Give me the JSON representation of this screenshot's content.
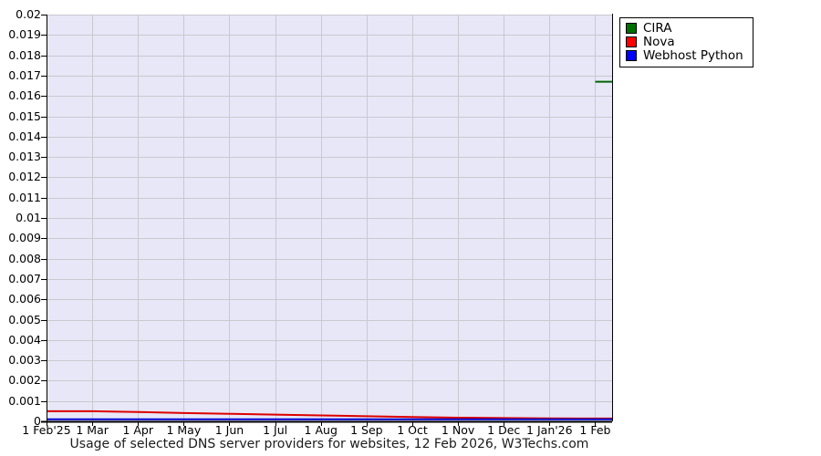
{
  "chart_data": {
    "type": "line",
    "title": "Usage of selected DNS server providers for websites, 12 Feb 2026, W3Techs.com",
    "x_axis": {
      "tick_labels": [
        "1 Feb'25",
        "1 Mar",
        "1 Apr",
        "1 May",
        "1 Jun",
        "1 Jul",
        "1 Aug",
        "1 Sep",
        "1 Oct",
        "1 Nov",
        "1 Dec",
        "1 Jan'26",
        "1 Feb"
      ],
      "months_span": 12.37,
      "gridlines": true
    },
    "y_axis": {
      "min": 0,
      "max": 0.02,
      "tick_step": 0.001,
      "tick_labels": [
        "0",
        "0.001",
        "0.002",
        "0.003",
        "0.004",
        "0.005",
        "0.006",
        "0.007",
        "0.008",
        "0.009",
        "0.01",
        "0.011",
        "0.012",
        "0.013",
        "0.014",
        "0.015",
        "0.016",
        "0.017",
        "0.018",
        "0.019",
        "0.02"
      ],
      "gridlines": true
    },
    "legend": {
      "position": "top-right-outside",
      "entries": [
        "CIRA",
        "Nova",
        "Webhost Python"
      ]
    },
    "series": [
      {
        "name": "CIRA",
        "color": "#006400",
        "swatch_color": "#006e00",
        "points": [
          [
            12,
            0.0167
          ],
          [
            12.37,
            0.0167
          ]
        ]
      },
      {
        "name": "Nova",
        "color": "#dd0000",
        "swatch_color": "#ff0000",
        "points": [
          [
            0,
            0.0005
          ],
          [
            1,
            0.0005
          ],
          [
            2,
            0.00046
          ],
          [
            3,
            0.00041
          ],
          [
            4,
            0.00037
          ],
          [
            5,
            0.00033
          ],
          [
            6,
            0.00029
          ],
          [
            7,
            0.00025
          ],
          [
            8,
            0.00021
          ],
          [
            9,
            0.00018
          ],
          [
            10,
            0.00016
          ],
          [
            11,
            0.00015
          ],
          [
            12,
            0.00014
          ],
          [
            12.37,
            0.00014
          ]
        ]
      },
      {
        "name": "Webhost Python",
        "color": "#0000cc",
        "swatch_color": "#0000ff",
        "points": [
          [
            0,
            0.0001
          ],
          [
            12.37,
            0.0001
          ]
        ]
      }
    ],
    "colors": {
      "plot_background": "#e7e7f8",
      "grid": "#c9c9ce",
      "axis": "#000000",
      "legend_border": "#000000",
      "legend_background": "#ffffff"
    }
  }
}
